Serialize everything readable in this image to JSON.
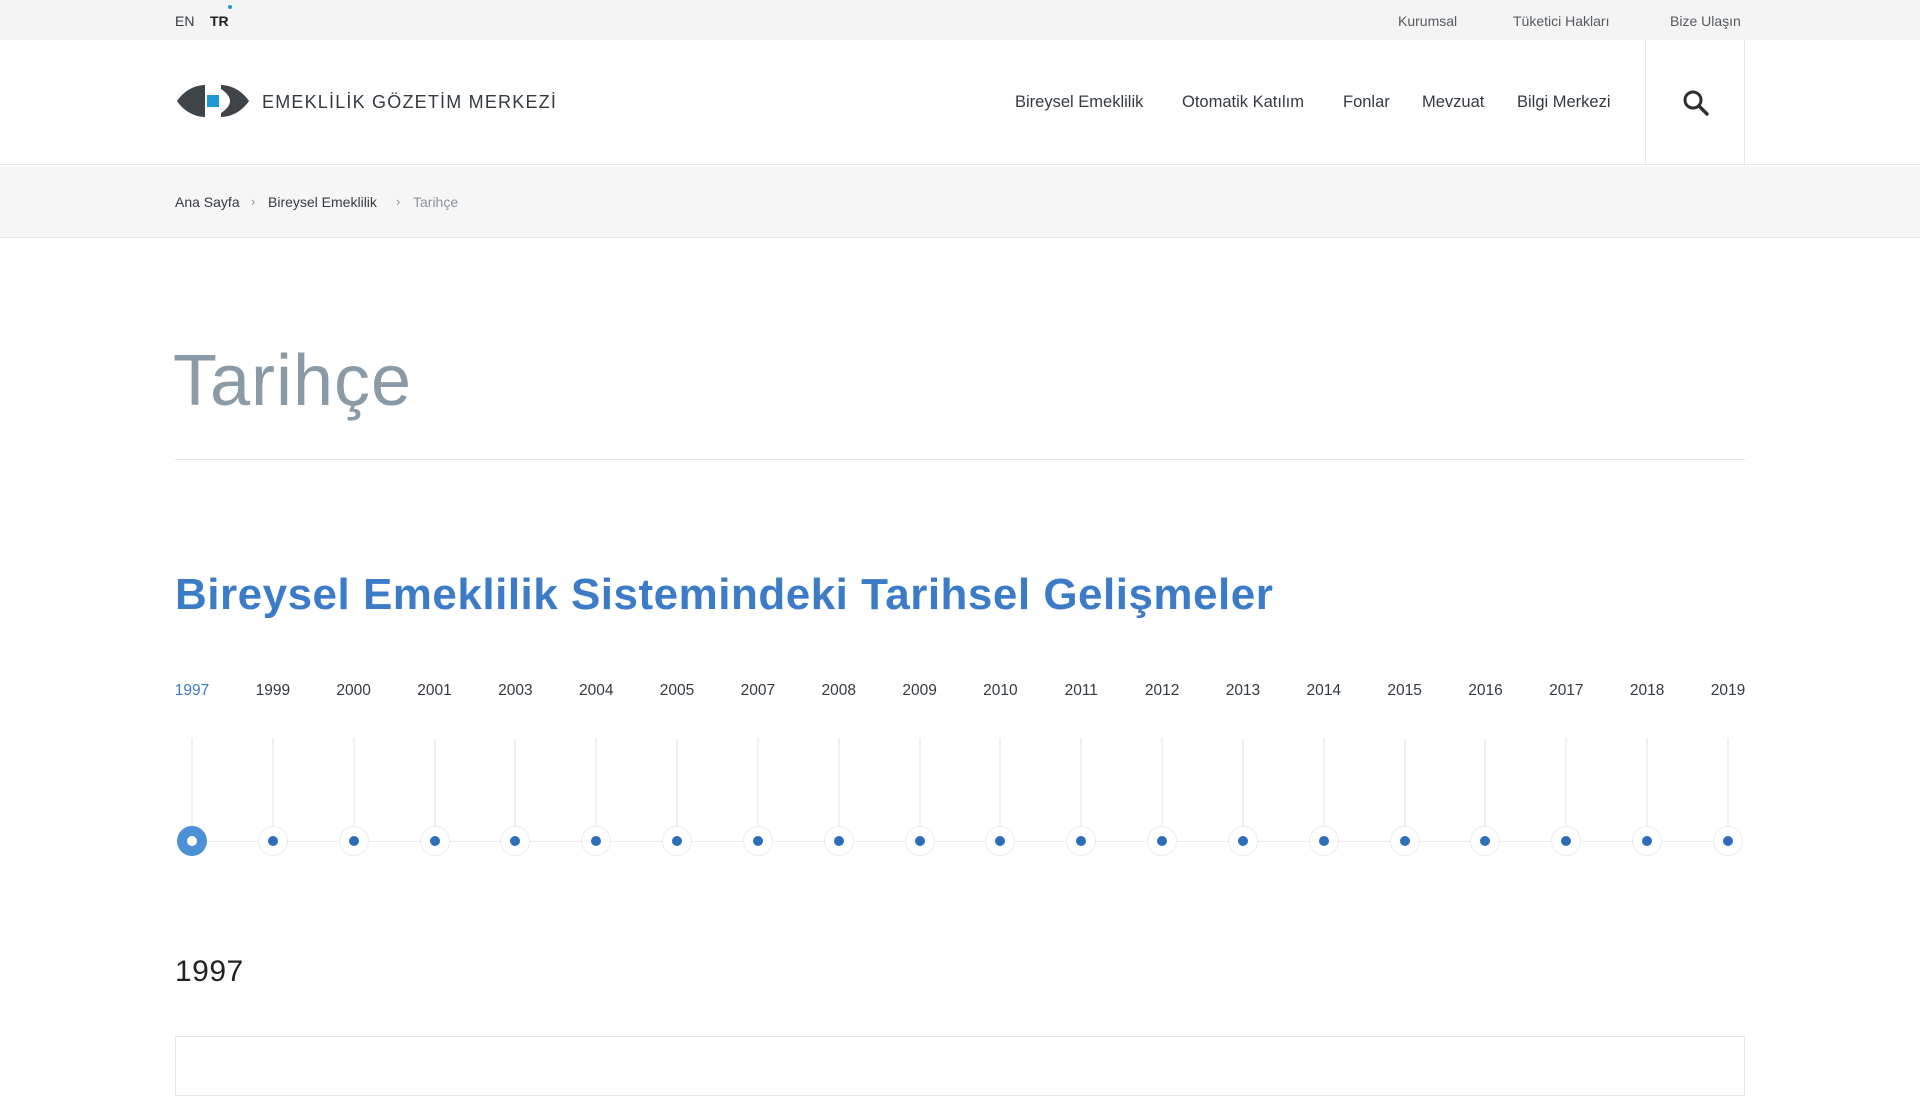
{
  "topbar": {
    "languages": [
      "EN",
      "TR"
    ],
    "links": [
      "Kurumsal",
      "Tüketici Hakları",
      "Bize Ulaşın"
    ]
  },
  "header": {
    "logo_text": "EMEKLİLİK GÖZETİM MERKEZİ",
    "nav": [
      "Bireysel Emeklilik",
      "Otomatik Katılım",
      "Fonlar",
      "Mevzuat",
      "Bilgi Merkezi"
    ],
    "search_icon": "search-icon"
  },
  "breadcrumb": {
    "items": [
      "Ana Sayfa",
      "Bireysel Emeklilik",
      "Tarihçe"
    ],
    "separator": ">"
  },
  "page": {
    "title": "Tarihçe",
    "section_title": "Bireysel Emeklilik Sistemindeki Tarihsel Gelişmeler"
  },
  "timeline": {
    "active_year": "1997",
    "years": [
      "1997",
      "1999",
      "2000",
      "2001",
      "2003",
      "2004",
      "2005",
      "2007",
      "2008",
      "2009",
      "2010",
      "2011",
      "2012",
      "2013",
      "2014",
      "2015",
      "2016",
      "2017",
      "2018",
      "2019"
    ]
  },
  "detail": {
    "year": "1997"
  },
  "colors": {
    "accent": "#3b7bc8",
    "brand_blue": "#1d9ad6",
    "title_gray": "#8a9aa6"
  }
}
